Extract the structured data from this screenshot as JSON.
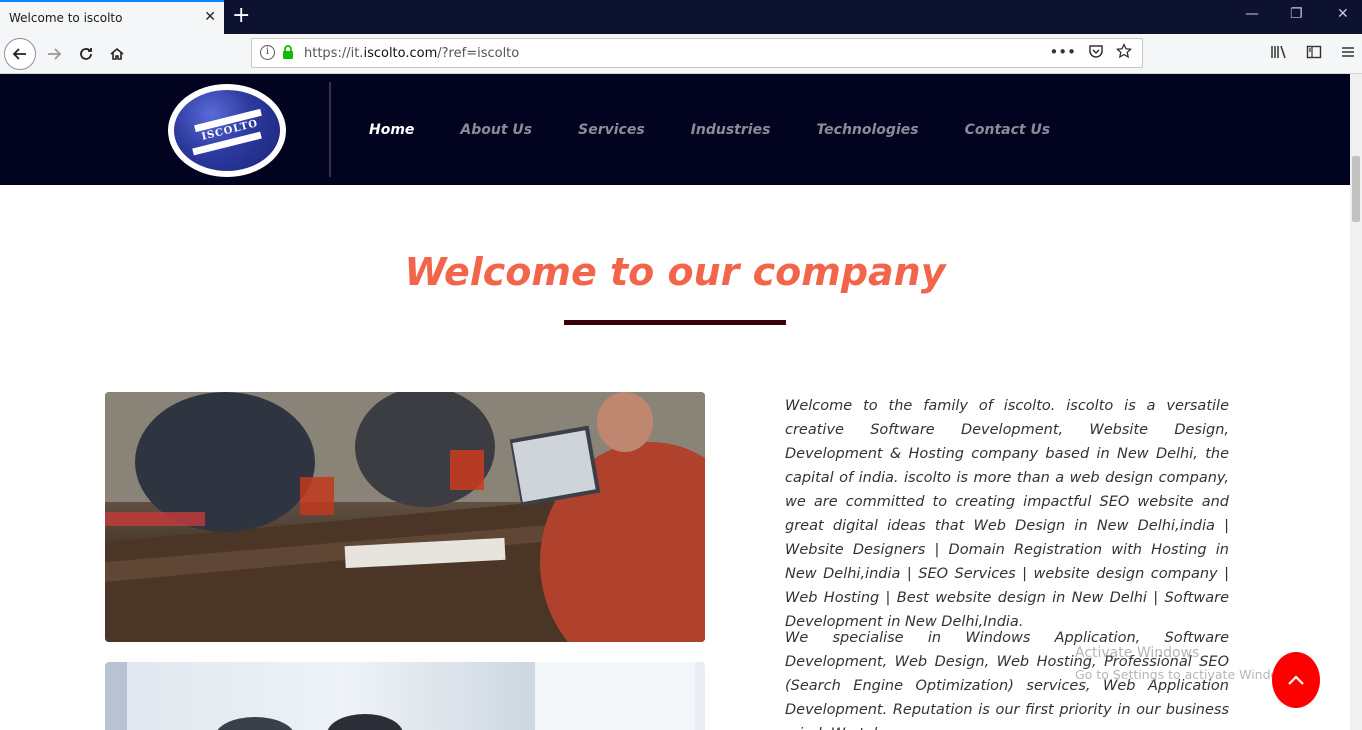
{
  "browser": {
    "tab_title": "Welcome to iscolto",
    "tab_close": "✕",
    "new_tab": "+",
    "url_prefix": "https://it.",
    "url_domain": "iscolto.com",
    "url_suffix": "/?ref=iscolto",
    "window_minimize": "—",
    "window_restore": "❐",
    "window_close": "✕"
  },
  "site": {
    "logo_text": "ISCOLTO",
    "menu": [
      {
        "label": "Home",
        "active": true
      },
      {
        "label": "About Us"
      },
      {
        "label": "Services"
      },
      {
        "label": "Industries"
      },
      {
        "label": "Technologies"
      },
      {
        "label": "Contact Us"
      }
    ],
    "welcome_title": "Welcome to our company",
    "paragraph1": "Welcome to the family of iscolto. iscolto is a versatile creative Software Development, Website Design, Development & Hosting company based in New Delhi, the capital of india. iscolto is more than a web design company, we are committed to creating impactful SEO website and great digital ideas that Web Design in New Delhi,india | Website Designers | Domain Registration with Hosting in New Delhi,india | SEO Services | website design company | Web Hosting | Best website design in New Delhi | Software Development in New Delhi,India.",
    "paragraph2": "We specialise in Windows Application, Software Development, Web Design, Web Hosting, Professional SEO (Search Engine Optimization) services, Web Application Development. Reputation is our first priority in our business mind. We take",
    "activate_line1": "Activate Windows",
    "activate_line2": "Go to Settings to activate Windows.",
    "to_top_icon": "chevron-up-icon"
  },
  "colors": {
    "header_bg": "#02031f",
    "title_color": "#f2654a",
    "rule_color": "#3b0207",
    "to_top_bg": "#ff0000"
  }
}
